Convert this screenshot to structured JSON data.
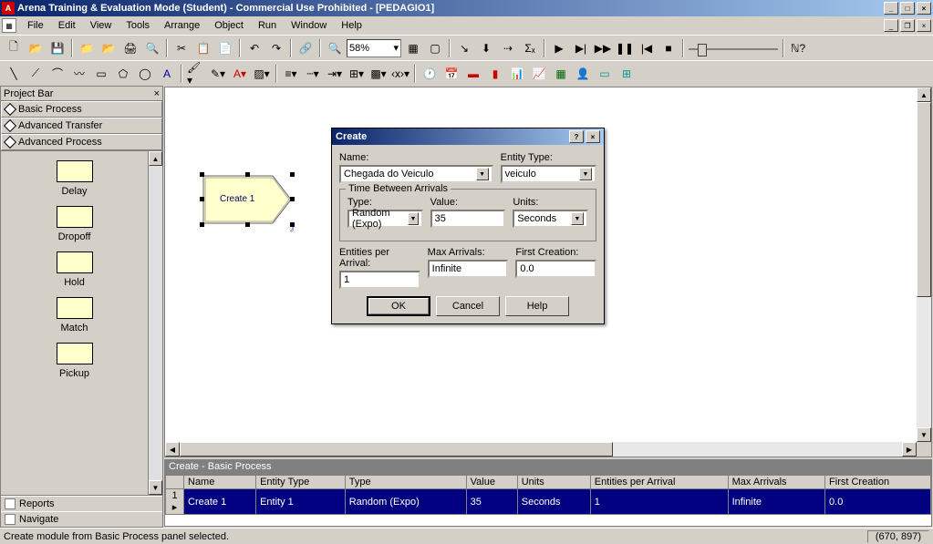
{
  "window": {
    "title": "Arena Training & Evaluation Mode (Student) - Commercial Use Prohibited - [PEDAGIO1]",
    "app_icon_text": "A"
  },
  "menus": [
    "File",
    "Edit",
    "View",
    "Tools",
    "Arrange",
    "Object",
    "Run",
    "Window",
    "Help"
  ],
  "toolbar": {
    "zoom": "58%"
  },
  "projectbar": {
    "title": "Project Bar",
    "sections": [
      "Basic Process",
      "Advanced Transfer",
      "Advanced Process"
    ],
    "items": [
      "Delay",
      "Dropoff",
      "Hold",
      "Match",
      "Pickup"
    ],
    "bottom": [
      "Reports",
      "Navigate"
    ]
  },
  "canvas": {
    "module_label": "Create 1"
  },
  "dialog": {
    "title": "Create",
    "labels": {
      "name": "Name:",
      "entity_type": "Entity Type:",
      "tba": "Time Between Arrivals",
      "type": "Type:",
      "value": "Value:",
      "units": "Units:",
      "epa": "Entities per Arrival:",
      "maxa": "Max Arrivals:",
      "first": "First Creation:"
    },
    "values": {
      "name": "Chegada do Veiculo",
      "entity_type": "veiculo",
      "type": "Random (Expo)",
      "value": "35",
      "units": "Seconds",
      "epa": "1",
      "maxa": "Infinite",
      "first": "0.0"
    },
    "buttons": {
      "ok": "OK",
      "cancel": "Cancel",
      "help": "Help"
    }
  },
  "spreadsheet": {
    "title": "Create - Basic Process",
    "headers": [
      "Name",
      "Entity Type",
      "Type",
      "Value",
      "Units",
      "Entities per Arrival",
      "Max Arrivals",
      "First Creation"
    ],
    "row": [
      "Create 1",
      "Entity 1",
      "Random (Expo)",
      "35",
      "Seconds",
      "1",
      "Infinite",
      "0.0"
    ],
    "rownum": "1"
  },
  "statusbar": {
    "message": "Create module from Basic Process panel selected.",
    "coords": "(670, 897)"
  }
}
